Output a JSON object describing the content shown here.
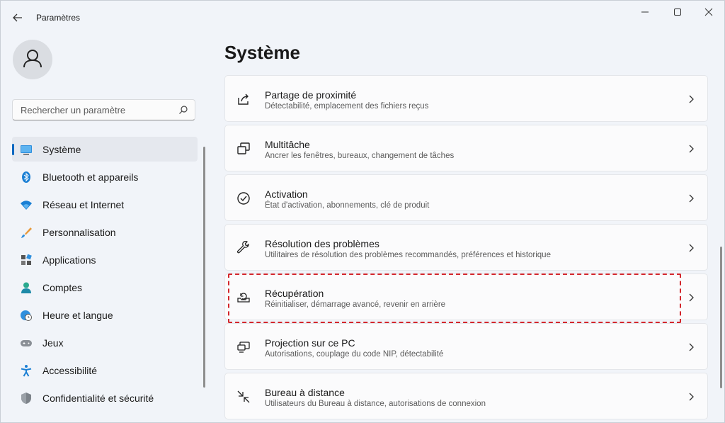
{
  "window": {
    "title": "Paramètres",
    "back_icon": "back-arrow-icon",
    "controls": [
      "minimize-icon",
      "maximize-icon",
      "close-icon"
    ]
  },
  "sidebar": {
    "avatar_icon": "user-icon",
    "search": {
      "placeholder": "Rechercher un paramètre",
      "icon": "search-icon"
    },
    "items": [
      {
        "label": "Système",
        "icon": "monitor-icon",
        "active": true
      },
      {
        "label": "Bluetooth et appareils",
        "icon": "bluetooth-icon"
      },
      {
        "label": "Réseau et Internet",
        "icon": "wifi-icon"
      },
      {
        "label": "Personnalisation",
        "icon": "brush-icon"
      },
      {
        "label": "Applications",
        "icon": "apps-icon"
      },
      {
        "label": "Comptes",
        "icon": "account-icon"
      },
      {
        "label": "Heure et langue",
        "icon": "globe-clock-icon"
      },
      {
        "label": "Jeux",
        "icon": "gamepad-icon"
      },
      {
        "label": "Accessibilité",
        "icon": "accessibility-icon"
      },
      {
        "label": "Confidentialité et sécurité",
        "icon": "shield-icon"
      }
    ]
  },
  "main": {
    "title": "Système",
    "cards": [
      {
        "title": "Partage de proximité",
        "subtitle": "Détectabilité, emplacement des fichiers reçus",
        "icon": "share-icon"
      },
      {
        "title": "Multitâche",
        "subtitle": "Ancrer les fenêtres, bureaux, changement de tâches",
        "icon": "multitask-icon"
      },
      {
        "title": "Activation",
        "subtitle": "État d'activation, abonnements, clé de produit",
        "icon": "check-circle-icon"
      },
      {
        "title": "Résolution des problèmes",
        "subtitle": "Utilitaires de résolution des problèmes recommandés, préférences et historique",
        "icon": "wrench-icon"
      },
      {
        "title": "Récupération",
        "subtitle": "Réinitialiser, démarrage avancé, revenir en arrière",
        "icon": "recovery-icon",
        "highlighted": true
      },
      {
        "title": "Projection sur ce PC",
        "subtitle": "Autorisations, couplage du code NIP, détectabilité",
        "icon": "projection-icon"
      },
      {
        "title": "Bureau à distance",
        "subtitle": "Utilisateurs du Bureau à distance, autorisations de connexion",
        "icon": "remote-desktop-icon"
      }
    ]
  },
  "colors": {
    "accent": "#0067c0",
    "highlight_border": "#d3262c",
    "background": "#f1f4f9"
  }
}
